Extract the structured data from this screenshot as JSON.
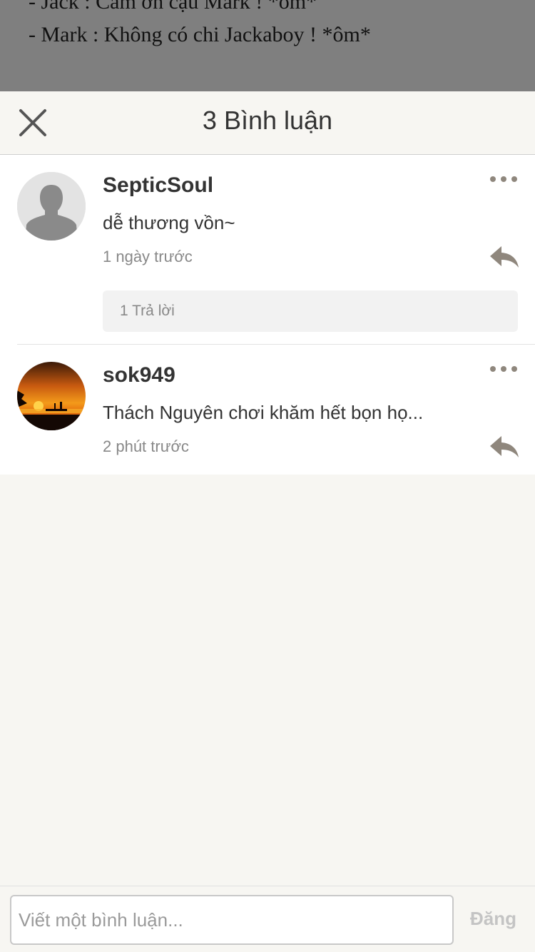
{
  "background_story": {
    "line1": "- Jack : Cảm ơn cậu Mark ! *ôm*",
    "line2": "- Mark : Không có chi Jackaboy ! *ôm*"
  },
  "header": {
    "title": "3 Bình luận",
    "close_icon": "close-icon"
  },
  "comments": [
    {
      "username": "SepticSoul",
      "text": "dễ thương vồn~",
      "time": "1 ngày trước",
      "replies_label": "1 Trả lời",
      "avatar": "default-avatar"
    },
    {
      "username": "sok949",
      "text": "Thách Nguyên chơi khăm hết bọn họ...",
      "time": "2 phút trước",
      "avatar": "sunset-avatar"
    }
  ],
  "composer": {
    "placeholder": "Viết một bình luận...",
    "post_label": "Đăng"
  },
  "colors": {
    "accent_icon": "#8f877d",
    "background": "#f7f6f2"
  }
}
